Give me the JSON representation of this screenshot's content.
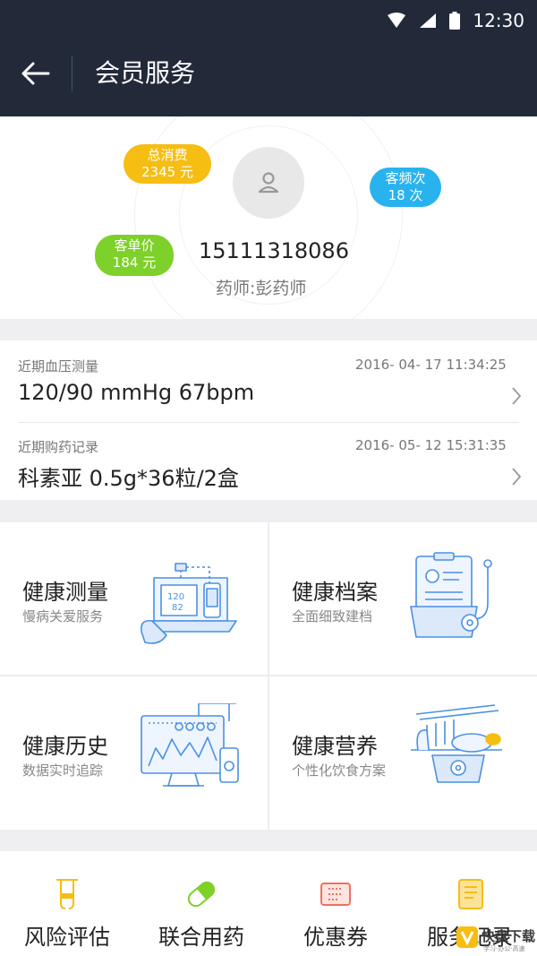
{
  "status_bar": {
    "time": "12:30"
  },
  "app_bar": {
    "title": "会员服务"
  },
  "member": {
    "total_spend": {
      "label": "总消费",
      "value": "2345 元"
    },
    "visit_freq": {
      "label": "客频次",
      "value": "18 次"
    },
    "unit_price": {
      "label": "客单价",
      "value": "184 元"
    },
    "phone": "15111318086",
    "pharmacist": "药师:彭药师"
  },
  "records": [
    {
      "label": "近期血压测量",
      "time": "2016- 04- 17 11:34:25",
      "value": "120/90 mmHg   67bpm"
    },
    {
      "label": "近期购药记录",
      "time": "2016- 05- 12 15:31:35",
      "value": "科素亚 0.5g*36粒/2盒"
    }
  ],
  "services": [
    {
      "title": "健康测量",
      "subtitle": "慢病关爱服务",
      "icon": "bp-monitor-illustration",
      "screen_text": [
        "120",
        "82"
      ]
    },
    {
      "title": "健康档案",
      "subtitle": "全面细致建档",
      "icon": "health-record-illustration"
    },
    {
      "title": "健康历史",
      "subtitle": "数据实时追踪",
      "icon": "history-chart-illustration"
    },
    {
      "title": "健康营养",
      "subtitle": "个性化饮食方案",
      "icon": "nutrition-scale-illustration"
    }
  ],
  "tools": [
    {
      "label": "风险评估",
      "icon": "test-tube-icon",
      "color": "#f6bd12"
    },
    {
      "label": "联合用药",
      "icon": "capsule-icon",
      "color": "#7ed02a"
    },
    {
      "label": "优惠券",
      "icon": "coupon-icon",
      "color": "#f07060"
    },
    {
      "label": "服务记录",
      "icon": "notebook-icon",
      "color": "#f6bd12"
    }
  ],
  "colors": {
    "header": "#222a3a",
    "accent_yellow": "#f6bd12",
    "accent_blue": "#29b3ee",
    "accent_green": "#7ed02a",
    "illustration_blue": "#4a90e2"
  },
  "watermark": {
    "text": "快盘下载",
    "subtext": "学习·办公·高速"
  }
}
